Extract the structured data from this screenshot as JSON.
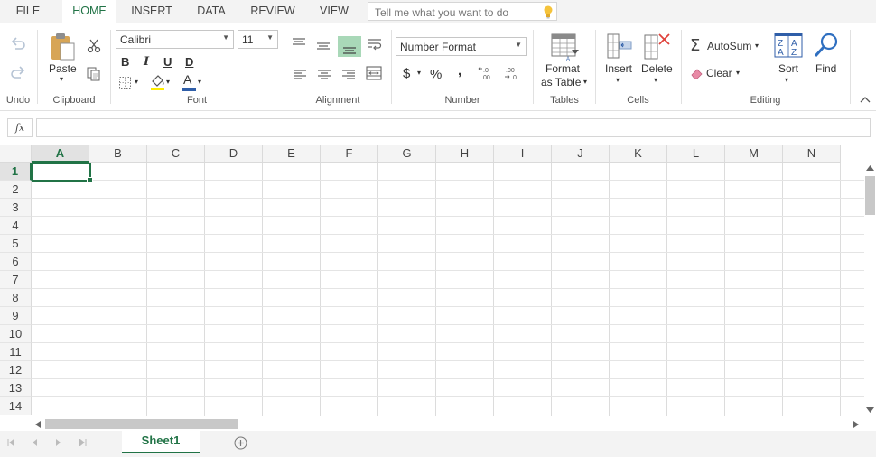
{
  "menu": {
    "tabs": [
      {
        "label": "FILE",
        "active": false
      },
      {
        "label": "HOME",
        "active": true
      },
      {
        "label": "INSERT",
        "active": false
      },
      {
        "label": "DATA",
        "active": false
      },
      {
        "label": "REVIEW",
        "active": false
      },
      {
        "label": "VIEW",
        "active": false
      }
    ],
    "search_placeholder": "Tell me what you want to do"
  },
  "ribbon": {
    "groups": {
      "undo": "Undo",
      "clipboard": "Clipboard",
      "font": "Font",
      "alignment": "Alignment",
      "number": "Number",
      "tables": "Tables",
      "cells": "Cells",
      "editing": "Editing"
    },
    "clipboard": {
      "paste": "Paste"
    },
    "font": {
      "family": "Calibri",
      "size": "11",
      "bold": "B",
      "italic": "I",
      "underline": "U",
      "double_underline": "D",
      "font_color_letter": "A"
    },
    "number": {
      "format": "Number Format",
      "currency": "$",
      "percent": "%",
      "comma": ",",
      "inc_decimal": ".0",
      "dec_decimal": ".00"
    },
    "tables": {
      "format_line1": "Format",
      "format_line2": "as Table"
    },
    "cells": {
      "insert": "Insert",
      "delete": "Delete"
    },
    "editing": {
      "autosum": "AutoSum",
      "clear": "Clear",
      "sort": "Sort",
      "find": "Find"
    }
  },
  "formula_bar": {
    "fx": "fx",
    "value": ""
  },
  "grid": {
    "columns": [
      "A",
      "B",
      "C",
      "D",
      "E",
      "F",
      "G",
      "H",
      "I",
      "J",
      "K",
      "L",
      "M",
      "N"
    ],
    "rows": [
      "1",
      "2",
      "3",
      "4",
      "5",
      "6",
      "7",
      "8",
      "9",
      "10",
      "11",
      "12",
      "13",
      "14"
    ],
    "selected_cell": "A1"
  },
  "sheets": {
    "tabs": [
      "Sheet1"
    ],
    "active": "Sheet1"
  },
  "colors": {
    "accent": "#217346",
    "align_active": "#a9d8b8",
    "fill_swatch": "#ffee00",
    "font_swatch": "#2f5ea8"
  }
}
